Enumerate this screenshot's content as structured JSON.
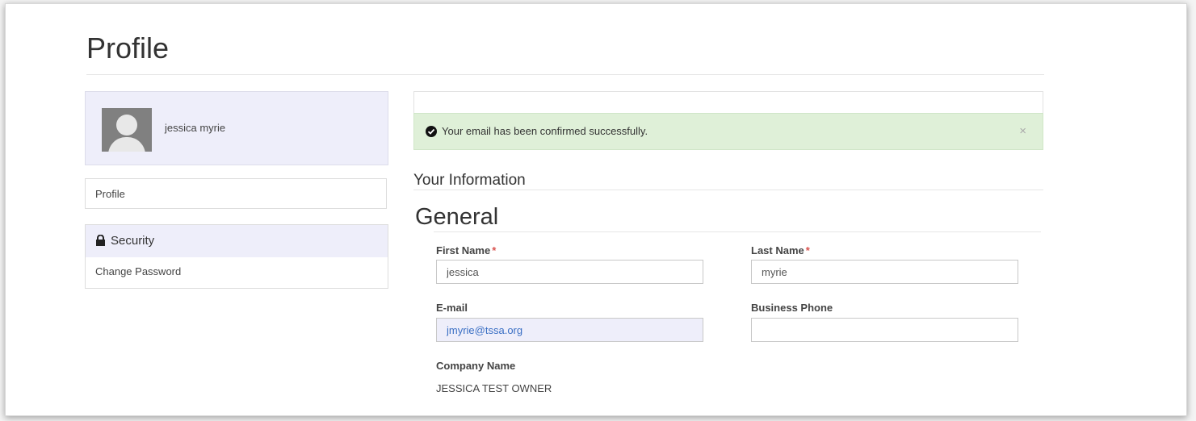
{
  "page": {
    "title": "Profile"
  },
  "sidebar": {
    "user_name": "jessica myrie",
    "profile_link": "Profile",
    "security_heading": "Security",
    "change_password": "Change Password"
  },
  "alert": {
    "message": "Your email has been confirmed successfully.",
    "close": "×"
  },
  "form": {
    "section_title": "Your Information",
    "group_title": "General",
    "first_name": {
      "label": "First Name",
      "required": "*",
      "value": "jessica"
    },
    "last_name": {
      "label": "Last Name",
      "required": "*",
      "value": "myrie"
    },
    "email": {
      "label": "E-mail",
      "value": "jmyrie@tssa.org"
    },
    "business_phone": {
      "label": "Business Phone",
      "value": ""
    },
    "company_name": {
      "label": "Company Name",
      "value": "JESSICA TEST OWNER"
    }
  },
  "colors": {
    "alert_bg": "#dff0d8",
    "sidebar_highlight": "#eeeefa",
    "required": "#d9534f",
    "email_text": "#3a6fc4"
  },
  "icons": [
    "user-avatar-icon",
    "lock-icon",
    "check-circle-icon",
    "close-icon"
  ]
}
